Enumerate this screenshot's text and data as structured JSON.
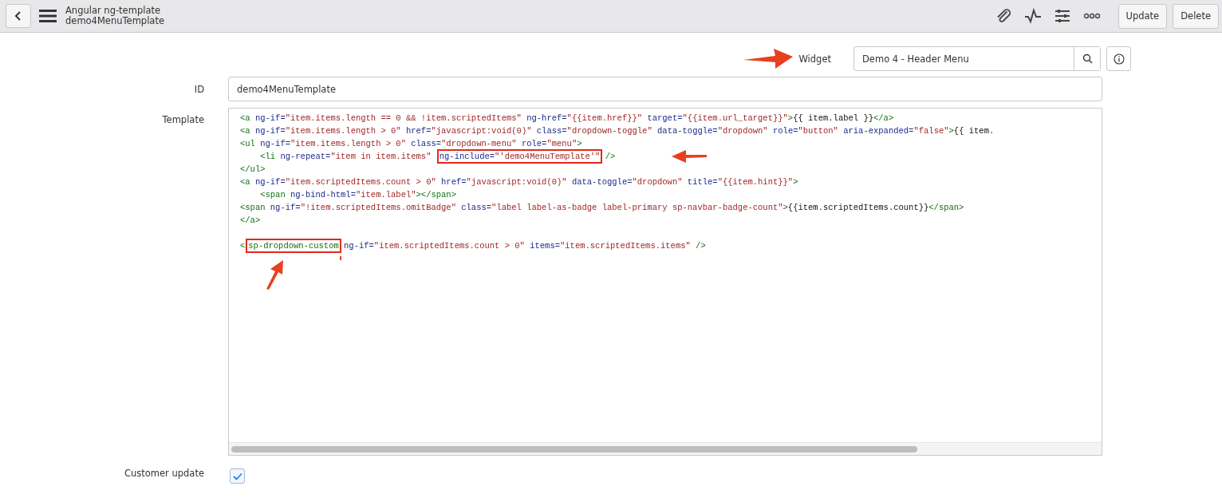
{
  "header": {
    "title": "Angular ng-template",
    "subtitle": "demo4MenuTemplate",
    "buttons": [
      "Update",
      "Delete"
    ]
  },
  "widget": {
    "label": "Widget",
    "value": "Demo 4 - Header Menu"
  },
  "fields": [
    {
      "kind": "text",
      "label": "ID",
      "value": "demo4MenuTemplate"
    },
    {
      "kind": "code",
      "label": "Template",
      "lines": [
        [
          {
            "kind": "tag",
            "text": "<a"
          },
          {
            "kind": "attr",
            "text": " ng-if="
          },
          {
            "kind": "value",
            "text": "\"item.items.length == 0 && !item.scriptedItems\""
          },
          {
            "kind": "attr",
            "text": " ng-href="
          },
          {
            "kind": "value",
            "text": "\"{{item.href}}\""
          },
          {
            "kind": "attr",
            "text": " target="
          },
          {
            "kind": "value",
            "text": "\"{{item.url_target}}\""
          },
          {
            "kind": "tag",
            "text": ">"
          },
          {
            "kind": "text",
            "text": "{{ item.label }}"
          },
          {
            "kind": "tag",
            "text": "</a>"
          }
        ],
        [
          {
            "kind": "tag",
            "text": "<a"
          },
          {
            "kind": "attr",
            "text": " ng-if="
          },
          {
            "kind": "value",
            "text": "\"item.items.length > 0\""
          },
          {
            "kind": "attr",
            "text": " href="
          },
          {
            "kind": "value",
            "text": "\"javascript:void(0)\""
          },
          {
            "kind": "attr",
            "text": " class="
          },
          {
            "kind": "value",
            "text": "\"dropdown-toggle\""
          },
          {
            "kind": "attr",
            "text": " data-toggle="
          },
          {
            "kind": "value",
            "text": "\"dropdown\""
          },
          {
            "kind": "attr",
            "text": " role="
          },
          {
            "kind": "value",
            "text": "\"button\""
          },
          {
            "kind": "attr",
            "text": " aria-expanded="
          },
          {
            "kind": "value",
            "text": "\"false\""
          },
          {
            "kind": "tag",
            "text": ">"
          },
          {
            "kind": "text",
            "text": "{{ item."
          }
        ],
        [
          {
            "kind": "tag",
            "text": "<ul"
          },
          {
            "kind": "attr",
            "text": " ng-if="
          },
          {
            "kind": "value",
            "text": "\"item.items.length > 0\""
          },
          {
            "kind": "attr",
            "text": " class="
          },
          {
            "kind": "value",
            "text": "\"dropdown-menu\""
          },
          {
            "kind": "attr",
            "text": " role="
          },
          {
            "kind": "value",
            "text": "\"menu\""
          },
          {
            "kind": "tag",
            "text": ">"
          }
        ],
        [
          {
            "kind": "tag",
            "text": "    <li"
          },
          {
            "kind": "attr",
            "text": " ng-repeat="
          },
          {
            "kind": "value",
            "text": "\"item in item.items\" "
          },
          {
            "kind": "mark",
            "tokens": [
              {
                "kind": "attr",
                "text": "ng-include="
              },
              {
                "kind": "value",
                "text": "\"'demo4MenuTemplate'\""
              }
            ]
          },
          {
            "kind": "tag",
            "text": " />"
          }
        ],
        [
          {
            "kind": "tag",
            "text": "</ul>"
          }
        ],
        [
          {
            "kind": "tag",
            "text": "<a"
          },
          {
            "kind": "attr",
            "text": " ng-if="
          },
          {
            "kind": "value",
            "text": "\"item.scriptedItems.count > 0\""
          },
          {
            "kind": "attr",
            "text": " href="
          },
          {
            "kind": "value",
            "text": "\"javascript:void(0)\""
          },
          {
            "kind": "attr",
            "text": " data-toggle="
          },
          {
            "kind": "value",
            "text": "\"dropdown\""
          },
          {
            "kind": "attr",
            "text": " title="
          },
          {
            "kind": "value",
            "text": "\"{{item.hint}}\""
          },
          {
            "kind": "tag",
            "text": ">"
          }
        ],
        [
          {
            "kind": "tag",
            "text": "    <span"
          },
          {
            "kind": "attr",
            "text": " ng-bind-html="
          },
          {
            "kind": "value",
            "text": "\"item.label\""
          },
          {
            "kind": "tag",
            "text": "></span>"
          }
        ],
        [
          {
            "kind": "tag",
            "text": "<span"
          },
          {
            "kind": "attr",
            "text": " ng-if="
          },
          {
            "kind": "value",
            "text": "\"!item.scriptedItems.omitBadge\""
          },
          {
            "kind": "attr",
            "text": " class="
          },
          {
            "kind": "value",
            "text": "\"label label-as-badge label-primary sp-navbar-badge-count\""
          },
          {
            "kind": "tag",
            "text": ">"
          },
          {
            "kind": "text",
            "text": "{{item.scriptedItems.count}}"
          },
          {
            "kind": "tag",
            "text": "</span>"
          }
        ],
        [
          {
            "kind": "tag",
            "text": "</a>"
          }
        ],
        [
          {
            "kind": "gap"
          },
          {
            "kind": "tag",
            "text": "<"
          },
          {
            "kind": "mark",
            "tokens": [
              {
                "kind": "tag",
                "text": "sp-dropdown-custom"
              }
            ]
          },
          {
            "kind": "attr",
            "text": " ng-if="
          },
          {
            "kind": "value",
            "text": "\"item.scriptedItems.count > 0\""
          },
          {
            "kind": "attr",
            "text": " items="
          },
          {
            "kind": "value",
            "text": "\"item.scriptedItems.items\""
          },
          {
            "kind": "tag",
            "text": " />"
          }
        ]
      ]
    },
    {
      "kind": "checkbox",
      "label": "Customer update",
      "checked": true
    }
  ]
}
